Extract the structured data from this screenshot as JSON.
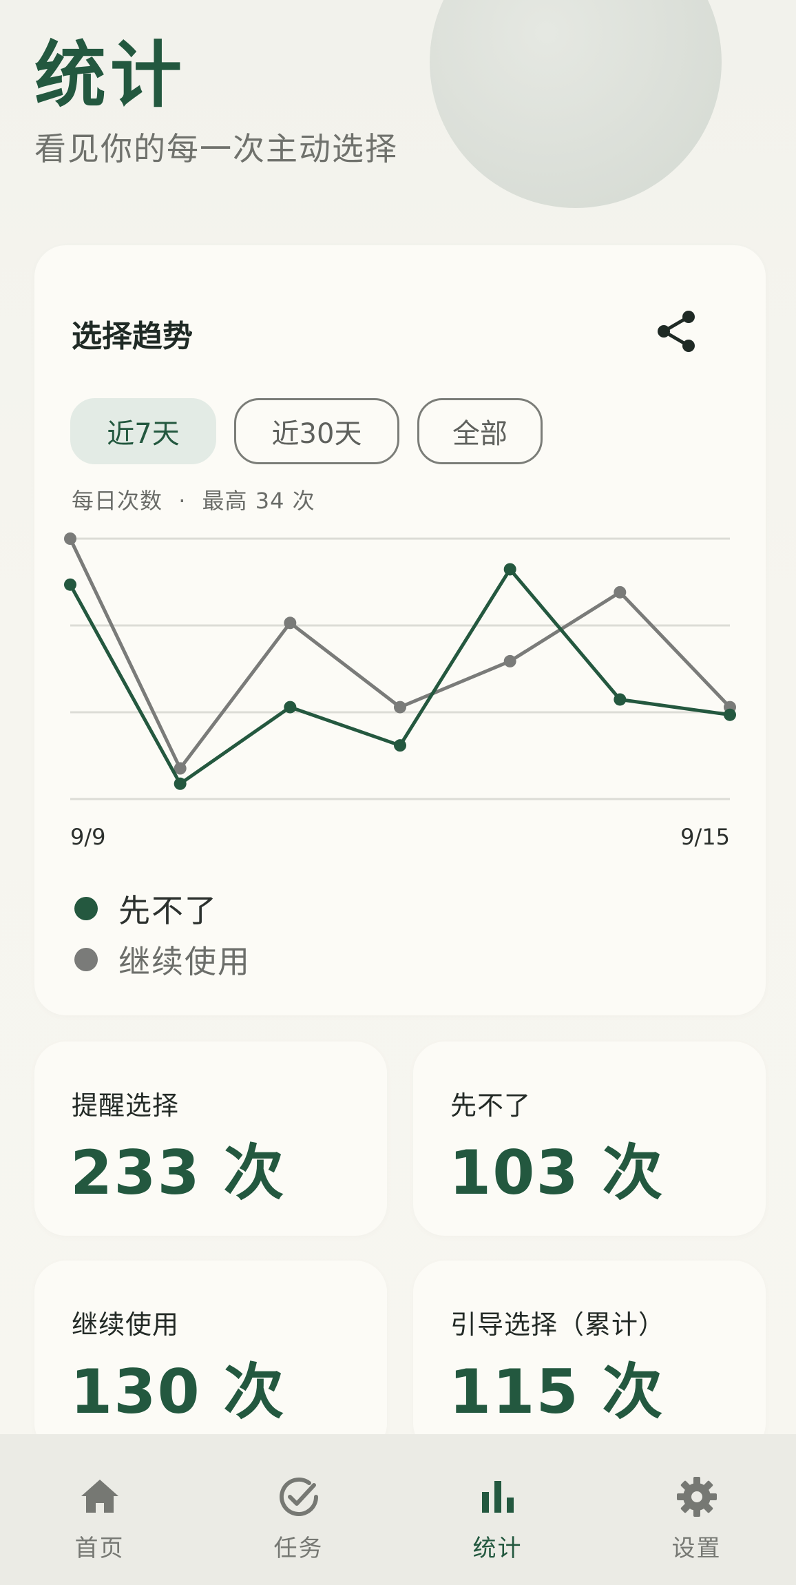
{
  "header": {
    "title": "统计",
    "subtitle": "看见你的每一次主动选择"
  },
  "trend": {
    "title": "选择趋势",
    "share_icon": "share-icon",
    "tabs": [
      {
        "label": "近7天",
        "active": true
      },
      {
        "label": "近30天",
        "active": false
      },
      {
        "label": "全部",
        "active": false
      }
    ],
    "meta_label": "每日次数",
    "meta_separator": "·",
    "meta_max": "最高 34 次"
  },
  "chart_data": {
    "type": "line",
    "x": [
      "9/9",
      "9/10",
      "9/11",
      "9/12",
      "9/13",
      "9/14",
      "9/15"
    ],
    "x_tick_labels": [
      "9/9",
      "9/15"
    ],
    "ylim": [
      0,
      34
    ],
    "grid": true,
    "legend": "bottom-left",
    "series": [
      {
        "name": "先不了",
        "color": "#24583f",
        "values": [
          28,
          2,
          12,
          7,
          30,
          13,
          11
        ]
      },
      {
        "name": "继续使用",
        "color": "#7a7b79",
        "values": [
          34,
          4,
          23,
          12,
          18,
          27,
          12
        ]
      }
    ]
  },
  "stats": [
    {
      "label": "提醒选择",
      "value": "233 次"
    },
    {
      "label": "先不了",
      "value": "103 次"
    },
    {
      "label": "继续使用",
      "value": "130 次"
    },
    {
      "label": "引导选择（累计）",
      "value": "115 次"
    }
  ],
  "nav": [
    {
      "label": "首页",
      "icon": "home-icon",
      "active": false
    },
    {
      "label": "任务",
      "icon": "check-circle-icon",
      "active": false
    },
    {
      "label": "统计",
      "icon": "bar-chart-icon",
      "active": true
    },
    {
      "label": "设置",
      "icon": "gear-icon",
      "active": false
    }
  ],
  "colors": {
    "accent": "#23583f",
    "muted": "#7a7b79",
    "card": "#fcfbf6",
    "background": "#f4f3ed",
    "nav_background": "#ebebe5"
  }
}
